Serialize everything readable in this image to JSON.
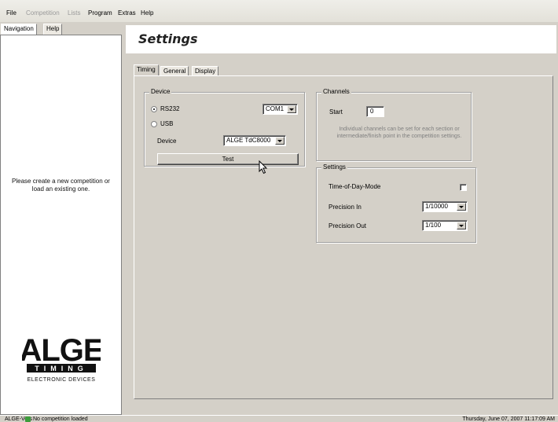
{
  "menu": {
    "items": [
      {
        "label": "File",
        "enabled": true
      },
      {
        "label": "Competition",
        "enabled": false
      },
      {
        "label": "Lists",
        "enabled": false
      },
      {
        "label": "Program",
        "enabled": true
      },
      {
        "label": "Extras",
        "enabled": true
      },
      {
        "label": "Help",
        "enabled": true
      }
    ]
  },
  "navigation": {
    "tabs": [
      {
        "label": "Navigation",
        "active": true
      },
      {
        "label": "Help",
        "active": false
      }
    ],
    "message": "Please create a new competition or load an existing one.",
    "logo": {
      "name": "ALGE",
      "subtitle1": "TIMING",
      "subtitle2": "ELECTRONIC DEVICES",
      "icon": "alge-logo"
    }
  },
  "settings": {
    "title": "Settings",
    "tabs": [
      {
        "label": "Timing",
        "active": true
      },
      {
        "label": "General",
        "active": false
      },
      {
        "label": "Display",
        "active": false
      }
    ],
    "device_group": {
      "label": "Device",
      "rs232_label": "RS232",
      "rs232_checked": true,
      "usb_label": "USB",
      "usb_checked": false,
      "port_value": "COM1",
      "device_label": "Device",
      "device_value": "ALGE TdC8000",
      "test_button": "Test"
    },
    "channels_group": {
      "label": "Channels",
      "start_label": "Start",
      "start_value": "0",
      "info_text": "Individual channels can be set for each section or intermediate/finish point in the competition settings."
    },
    "settings_group": {
      "label": "Settings",
      "time_of_day_label": "Time-of-Day-Mode",
      "time_of_day_checked": false,
      "precision_in_label": "Precision In",
      "precision_in_value": "1/10000",
      "precision_out_label": "Precision Out",
      "precision_out_value": "1/100"
    }
  },
  "statusbar": {
    "left_text": "ALGE-Vers",
    "status_text": "No competition loaded",
    "datetime": "Thursday, June 07, 2007  11:17:09 AM"
  },
  "colors": {
    "face": "#d4d0c8",
    "logo_dark": "#111111"
  }
}
